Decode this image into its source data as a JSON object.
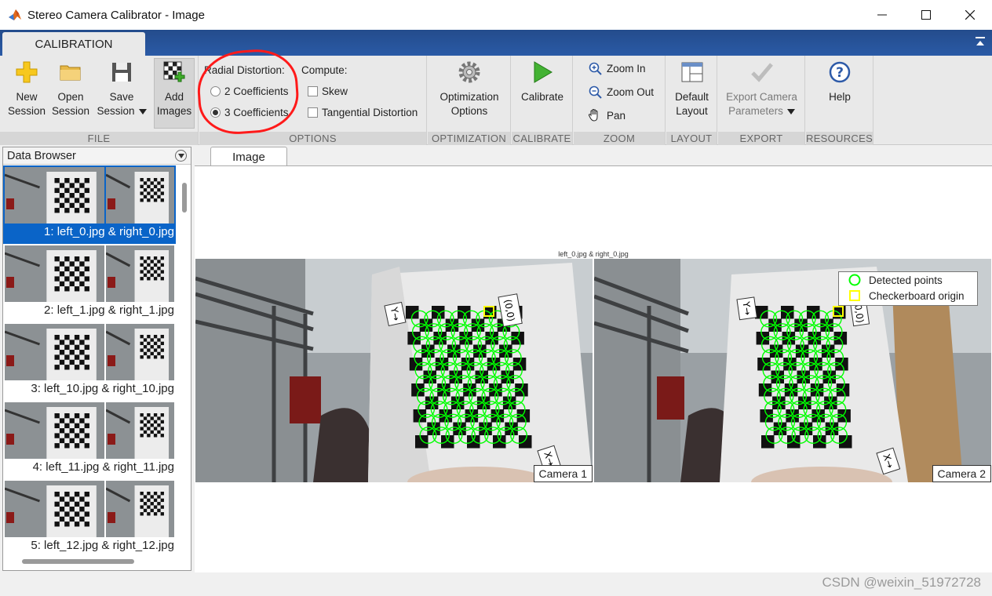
{
  "window": {
    "title": "Stereo Camera Calibrator - Image"
  },
  "ribbon": {
    "tab": "CALIBRATION",
    "file": {
      "group_label": "FILE",
      "new_session": [
        "New",
        "Session"
      ],
      "open_session": [
        "Open",
        "Session"
      ],
      "save_session": [
        "Save",
        "Session"
      ],
      "add_images": [
        "Add",
        "Images"
      ]
    },
    "options": {
      "group_label": "OPTIONS",
      "radial_label": "Radial Distortion:",
      "radial_2": "2 Coefficients",
      "radial_3": "3 Coefficients",
      "radial_selected": "3 Coefficients",
      "compute_label": "Compute:",
      "skew": "Skew",
      "tangential": "Tangential Distortion"
    },
    "optimization": {
      "group_label": "OPTIMIZATION",
      "button": [
        "Optimization",
        "Options"
      ]
    },
    "calibrate": {
      "group_label": "CALIBRATE",
      "button": "Calibrate"
    },
    "zoom": {
      "group_label": "ZOOM",
      "zoom_in": "Zoom In",
      "zoom_out": "Zoom Out",
      "pan": "Pan"
    },
    "layout": {
      "group_label": "LAYOUT",
      "button": [
        "Default",
        "Layout"
      ]
    },
    "export": {
      "group_label": "EXPORT",
      "button": [
        "Export Camera",
        "Parameters"
      ]
    },
    "resources": {
      "group_label": "RESOURCES",
      "button": "Help"
    }
  },
  "browser": {
    "title": "Data Browser",
    "items": [
      {
        "label": "1: left_0.jpg & right_0.jpg",
        "selected": true
      },
      {
        "label": "2: left_1.jpg & right_1.jpg",
        "selected": false
      },
      {
        "label": "3: left_10.jpg & right_10.jpg",
        "selected": false
      },
      {
        "label": "4: left_11.jpg & right_11.jpg",
        "selected": false
      },
      {
        "label": "5: left_12.jpg & right_12.jpg",
        "selected": false
      }
    ]
  },
  "document": {
    "tab": "Image",
    "figure_title": "left_0.jpg & right_0.jpg",
    "camera1": "Camera 1",
    "camera2": "Camera 2",
    "axis_x": "X→",
    "axis_y": "Y→",
    "origin": "(0,0)",
    "legend": {
      "detected": "Detected points",
      "origin": "Checkerboard origin"
    }
  },
  "colors": {
    "accent": "#1f4e99",
    "selection": "#0a64c8",
    "detected": "#00ff00",
    "origin": "#ffff00",
    "annotation": "#ff1a1a"
  },
  "watermark": "CSDN @weixin_51972728"
}
